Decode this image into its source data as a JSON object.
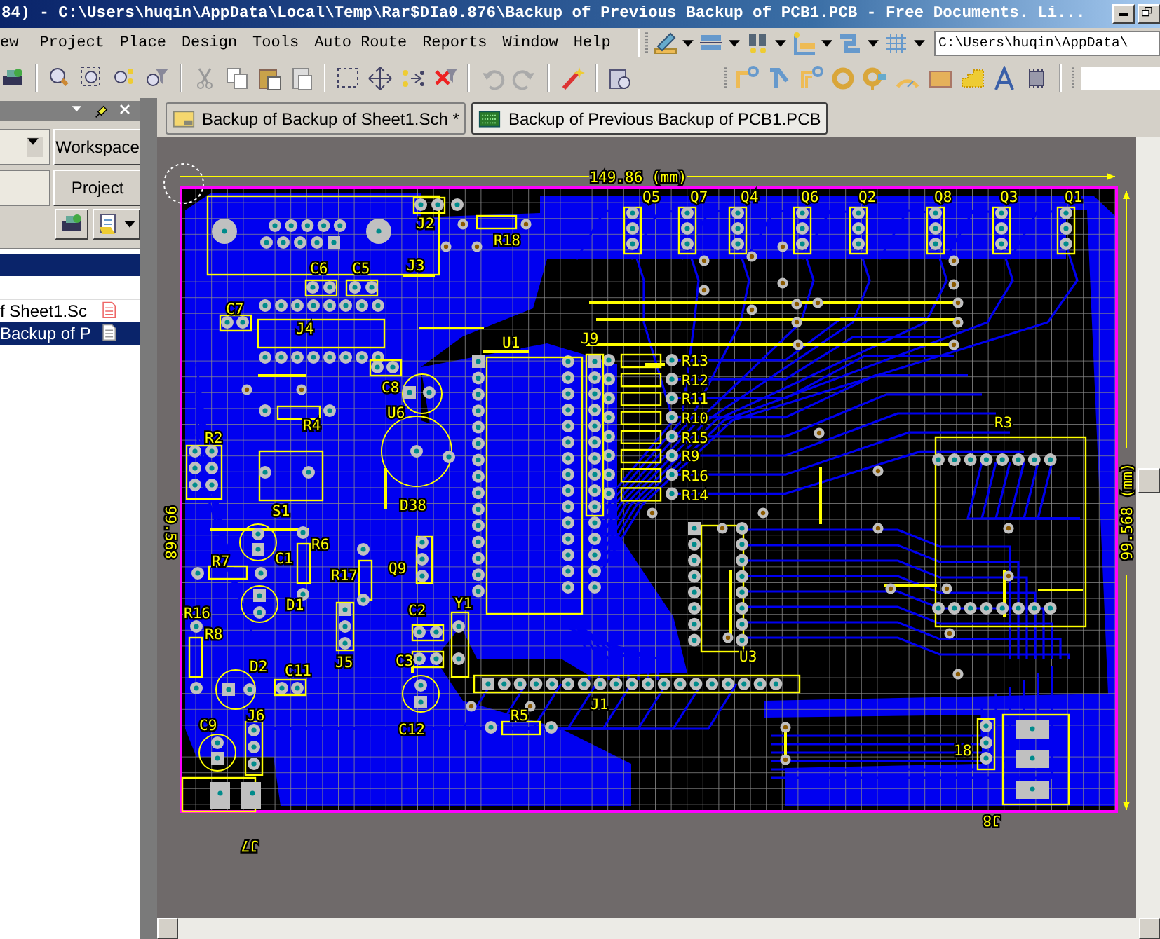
{
  "window": {
    "title": "84) - C:\\Users\\huqin\\AppData\\Local\\Temp\\Rar$DIa0.876\\Backup of Previous Backup of PCB1.PCB - Free Documents. Li..."
  },
  "menu": [
    "ew",
    "Project",
    "Place",
    "Design",
    "Tools",
    "Auto Route",
    "Reports",
    "Window",
    "Help"
  ],
  "toolbar": {
    "path_field": "C:\\Users\\huqin\\AppData\\"
  },
  "panel": {
    "buttons": [
      "Workspace",
      "Project"
    ],
    "files": [
      {
        "name": "f Sheet1.Sc",
        "kind": "schematic",
        "selected": false
      },
      {
        "name": "Backup of P",
        "kind": "pcb",
        "selected": true
      }
    ]
  },
  "tabs": [
    {
      "label": "Backup of Backup of Sheet1.Sch *",
      "kind": "schematic",
      "selected": false
    },
    {
      "label": "Backup of Previous Backup of PCB1.PCB",
      "kind": "pcb",
      "selected": true
    }
  ],
  "pcb": {
    "width_dimension": "149.86 (mm)",
    "height_dimension": "99.568 (mm)",
    "mirrored_height_dimension": "99.568",
    "labels": [
      {
        "text": "Q5",
        "kind": "top"
      },
      {
        "text": "Q7",
        "kind": "top"
      },
      {
        "text": "Q4",
        "kind": "top"
      },
      {
        "text": "Q6",
        "kind": "top"
      },
      {
        "text": "Q2",
        "kind": "top"
      },
      {
        "text": "Q8",
        "kind": "top"
      },
      {
        "text": "Q3",
        "kind": "top"
      },
      {
        "text": "Q1",
        "kind": "top"
      },
      {
        "text": "J2",
        "kind": "top"
      },
      {
        "text": "R18",
        "kind": "top"
      },
      {
        "text": "C6",
        "kind": "top"
      },
      {
        "text": "C5",
        "kind": "top"
      },
      {
        "text": "J3",
        "kind": "top"
      },
      {
        "text": "C7",
        "kind": "top"
      },
      {
        "text": "J4",
        "kind": "top"
      },
      {
        "text": "C8",
        "kind": "top"
      },
      {
        "text": "U6",
        "kind": "top"
      },
      {
        "text": "R4",
        "kind": "top"
      },
      {
        "text": "U1",
        "kind": "top"
      },
      {
        "text": "J9",
        "kind": "top"
      },
      {
        "text": "R13",
        "kind": "top"
      },
      {
        "text": "R12",
        "kind": "top"
      },
      {
        "text": "R11",
        "kind": "top"
      },
      {
        "text": "R10",
        "kind": "top"
      },
      {
        "text": "R15",
        "kind": "top"
      },
      {
        "text": "R9",
        "kind": "top"
      },
      {
        "text": "R16",
        "kind": "top"
      },
      {
        "text": "R14",
        "kind": "top"
      },
      {
        "text": "R2",
        "kind": "top"
      },
      {
        "text": "S1",
        "kind": "top"
      },
      {
        "text": "D38",
        "kind": "top"
      },
      {
        "text": "C1",
        "kind": "top"
      },
      {
        "text": "R6",
        "kind": "top"
      },
      {
        "text": "R7",
        "kind": "top"
      },
      {
        "text": "R17",
        "kind": "top"
      },
      {
        "text": "Q9",
        "kind": "top"
      },
      {
        "text": "D1",
        "kind": "top"
      },
      {
        "text": "R16",
        "kind": "top"
      },
      {
        "text": "R8",
        "kind": "top"
      },
      {
        "text": "D2",
        "kind": "top"
      },
      {
        "text": "C11",
        "kind": "top"
      },
      {
        "text": "J5",
        "kind": "top"
      },
      {
        "text": "C2",
        "kind": "top"
      },
      {
        "text": "Y1",
        "kind": "top"
      },
      {
        "text": "C3",
        "kind": "top"
      },
      {
        "text": "C12",
        "kind": "top"
      },
      {
        "text": "J6",
        "kind": "top"
      },
      {
        "text": "C9",
        "kind": "top"
      },
      {
        "text": "J1",
        "kind": "top"
      },
      {
        "text": "R5",
        "kind": "top"
      },
      {
        "text": "U3",
        "kind": "top"
      },
      {
        "text": "R3",
        "kind": "top"
      },
      {
        "text": "18",
        "kind": "top"
      },
      {
        "text": "J8",
        "kind": "bottom"
      },
      {
        "text": "J7",
        "kind": "bottom"
      }
    ]
  }
}
